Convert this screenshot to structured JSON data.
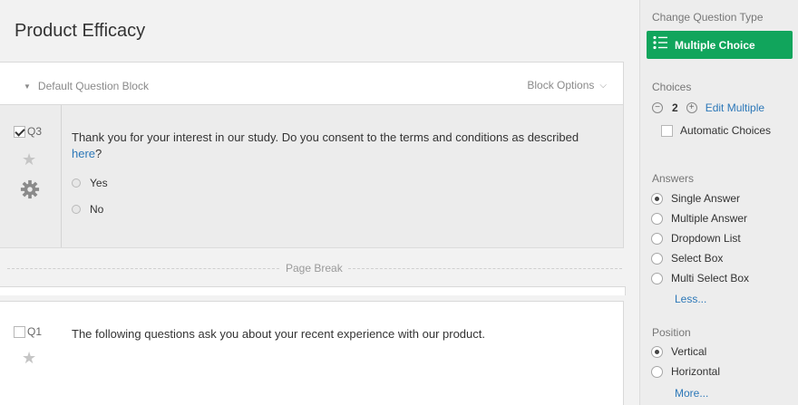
{
  "survey": {
    "title": "Product Efficacy"
  },
  "block": {
    "name": "Default Question Block",
    "options_label": "Block Options"
  },
  "questions": [
    {
      "id": "Q3",
      "checked": true,
      "text_before": "Thank you for your interest in our study. Do you consent to the terms and conditions as described ",
      "link_text": "here",
      "text_after": "?",
      "options": [
        "Yes",
        "No"
      ]
    },
    {
      "id": "Q1",
      "checked": false,
      "text": "The following questions ask you about your recent experience with our product."
    }
  ],
  "page_break": {
    "label": "Page Break"
  },
  "sidebar": {
    "change_type_label": "Change Question Type",
    "question_type": "Multiple Choice",
    "choices_label": "Choices",
    "choices_count": "2",
    "edit_multiple": "Edit Multiple",
    "automatic_choices": "Automatic Choices",
    "answers_label": "Answers",
    "answers": [
      "Single Answer",
      "Multiple Answer",
      "Dropdown List",
      "Select Box",
      "Multi Select Box"
    ],
    "answers_selected": "Single Answer",
    "less_link": "Less...",
    "position_label": "Position",
    "positions": [
      "Vertical",
      "Horizontal"
    ],
    "position_selected": "Vertical",
    "more_link": "More...",
    "accent_color": "#11a55c",
    "link_color": "#2d78b8"
  }
}
